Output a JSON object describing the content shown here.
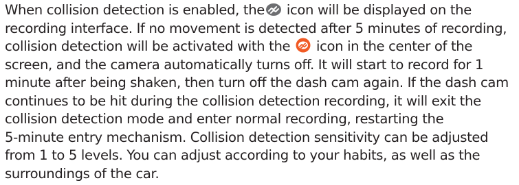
{
  "document": {
    "lines": [
      {
        "before": "When collision detection is enabled, the",
        "icon": "collision-outline-icon",
        "after": " icon will be displayed on the"
      },
      {
        "text": "recording interface. If no movement is detected after 5 minutes of recording,"
      },
      {
        "before": "collision detection will be activated with the ",
        "icon": "collision-filled-icon",
        "after": " icon in the center of the"
      },
      {
        "text": "screen, and the camera automatically turns off. It will start to record for 1"
      },
      {
        "text": "minute after being shaken, then turn off the dash cam again. If the dash cam"
      },
      {
        "text": "continues to be hit during the collision detection recording, it will exit the"
      },
      {
        "text": "collision detection mode and enter normal recording, restarting the"
      },
      {
        "text": "5-minute entry mechanism. Collision detection sensitivity can be adjusted"
      },
      {
        "text": "from 1 to 5 levels. You can adjust according to your habits, as well as the"
      },
      {
        "text": "surroundings of the car."
      }
    ],
    "colors": {
      "text": "#231f20",
      "icon_outline_fill": "#6d6e71",
      "icon_filled_bg": "#f15a24",
      "icon_filled_fg": "#ffffff"
    }
  }
}
